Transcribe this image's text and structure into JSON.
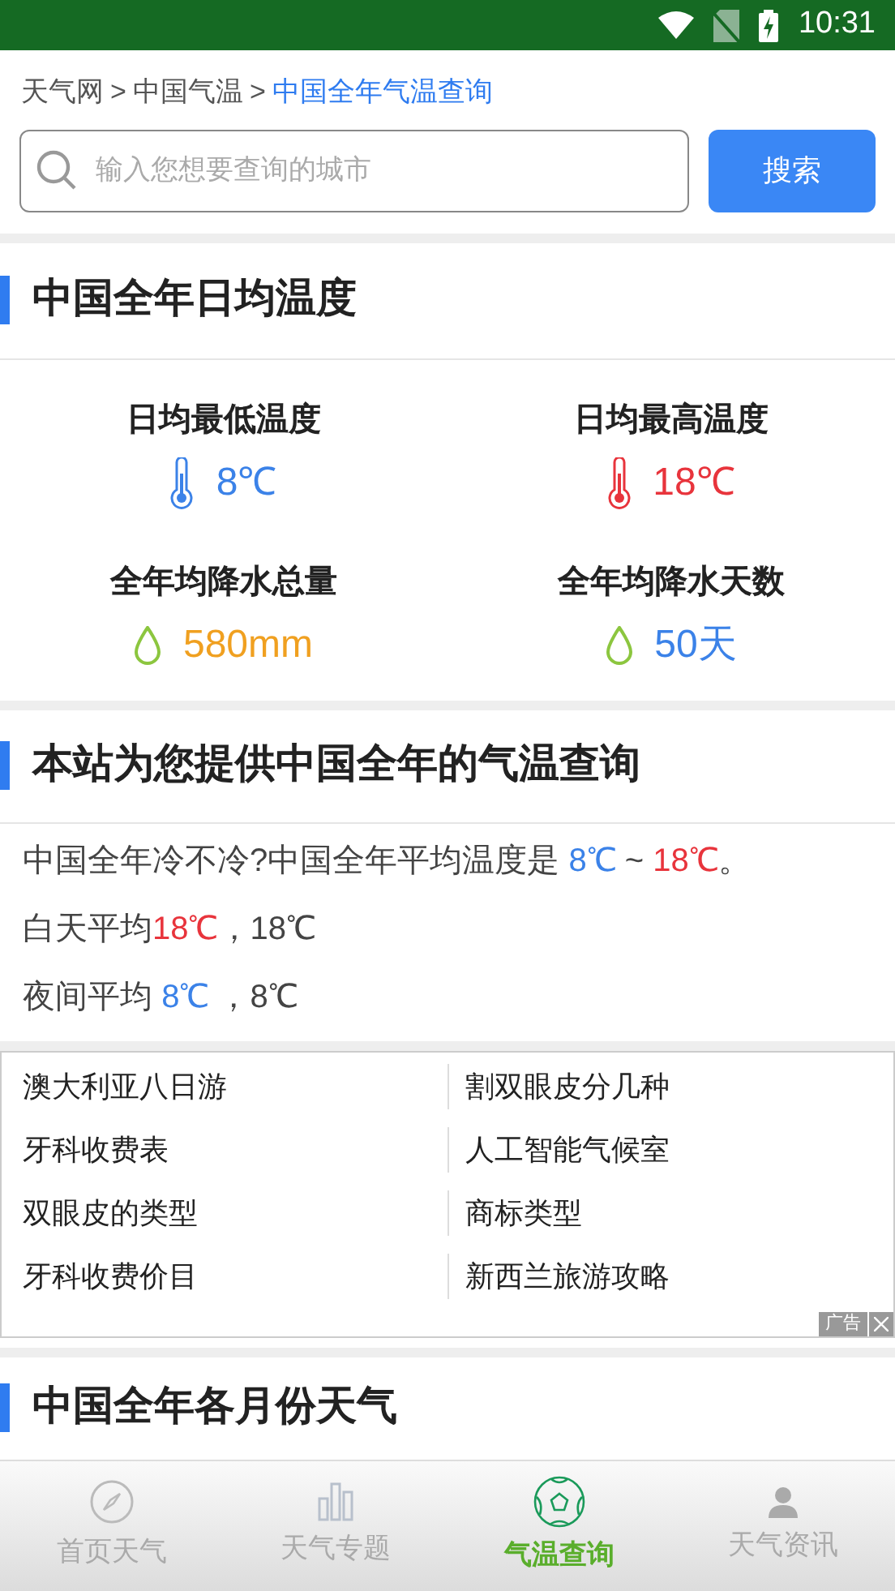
{
  "status_bar": {
    "time": "10:31"
  },
  "breadcrumb": {
    "separator": ">",
    "items": [
      {
        "label": "天气网",
        "current": false
      },
      {
        "label": "中国气温",
        "current": false
      },
      {
        "label": "中国全年气温查询",
        "current": true
      }
    ]
  },
  "search": {
    "placeholder": "输入您想要查询的城市",
    "button": "搜索"
  },
  "summary": {
    "title": "中国全年日均温度",
    "stats": [
      {
        "label": "日均最低温度",
        "value": "8℃",
        "kind": "thermometer",
        "color": "#3b82e8"
      },
      {
        "label": "日均最高温度",
        "value": "18℃",
        "kind": "thermometer",
        "color": "#e8343c"
      },
      {
        "label": "全年均降水总量",
        "value": "580mm",
        "kind": "drop",
        "color": "#f0a020"
      },
      {
        "label": "全年均降水天数",
        "value": "50天",
        "kind": "drop",
        "color": "#3b82e8"
      }
    ]
  },
  "query": {
    "title": "本站为您提供中国全年的气温查询",
    "lines": [
      [
        {
          "text": "中国全年冷不冷?中国全年平均温度是 ",
          "color": "#444444"
        },
        {
          "text": "8℃",
          "color": "#3b82e8"
        },
        {
          "text": " ~ ",
          "color": "#444444"
        },
        {
          "text": "18℃",
          "color": "#e8343c"
        },
        {
          "text": "。",
          "color": "#444444"
        }
      ],
      [
        {
          "text": "白天平均",
          "color": "#444444"
        },
        {
          "text": "18℃",
          "color": "#e8343c"
        },
        {
          "text": "，18℃",
          "color": "#444444"
        }
      ],
      [
        {
          "text": "夜间平均 ",
          "color": "#444444"
        },
        {
          "text": "8℃",
          "color": "#3b82e8"
        },
        {
          "text": " ，8℃",
          "color": "#444444"
        }
      ]
    ]
  },
  "ad": {
    "links": [
      "澳大利亚八日游",
      "割双眼皮分几种",
      "牙科收费表",
      "人工智能气候室",
      "双眼皮的类型",
      "商标类型",
      "牙科收费价目",
      "新西兰旅游攻略"
    ],
    "badge": "广告"
  },
  "months": {
    "title": "中国全年各月份天气"
  },
  "tab_bar": [
    {
      "label": "首页天气",
      "selected": false
    },
    {
      "label": "天气专题",
      "selected": false
    },
    {
      "label": "气温查询",
      "selected": true
    },
    {
      "label": "天气资讯",
      "selected": false
    }
  ]
}
